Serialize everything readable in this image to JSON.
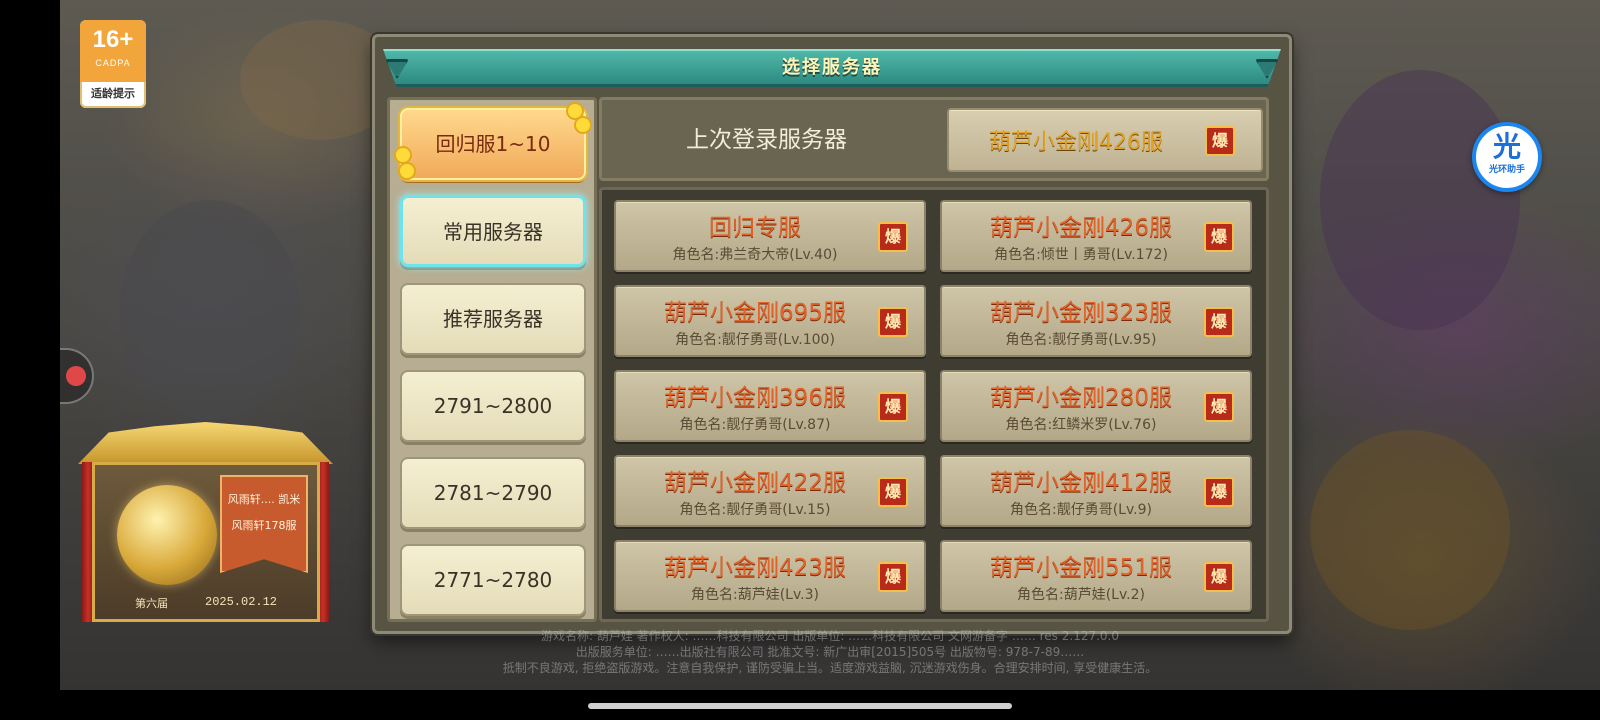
{
  "age_badge": {
    "age": "16+",
    "org": "CADPA",
    "tip": "适龄提示"
  },
  "helper": {
    "icon": "光",
    "label": "光环助手"
  },
  "honor": {
    "line1": "风雨轩.... 凯米",
    "line2": "风雨轩178服",
    "season": "第六届",
    "date": "2025.02.12"
  },
  "panel": {
    "title": "选择服务器",
    "tabs": [
      {
        "label": "回归服1~10",
        "state": "active"
      },
      {
        "label": "常用服务器",
        "state": "highlight"
      },
      {
        "label": "推荐服务器",
        "state": "normal"
      },
      {
        "label": "2791~2800",
        "state": "normal"
      },
      {
        "label": "2781~2790",
        "state": "normal"
      },
      {
        "label": "2771~2780",
        "state": "normal"
      }
    ],
    "last_login": {
      "label": "上次登录服务器",
      "server": "葫芦小金刚426服",
      "badge": "爆"
    },
    "servers": [
      {
        "name": "回归专服",
        "role": "角色名:弗兰奇大帝(Lv.40)",
        "badge": "爆"
      },
      {
        "name": "葫芦小金刚426服",
        "role": "角色名:倾世丨勇哥(Lv.172)",
        "badge": "爆"
      },
      {
        "name": "葫芦小金刚695服",
        "role": "角色名:靓仔勇哥(Lv.100)",
        "badge": "爆"
      },
      {
        "name": "葫芦小金刚323服",
        "role": "角色名:靓仔勇哥(Lv.95)",
        "badge": "爆"
      },
      {
        "name": "葫芦小金刚396服",
        "role": "角色名:靓仔勇哥(Lv.87)",
        "badge": "爆"
      },
      {
        "name": "葫芦小金刚280服",
        "role": "角色名:红鳞米罗(Lv.76)",
        "badge": "爆"
      },
      {
        "name": "葫芦小金刚422服",
        "role": "角色名:靓仔勇哥(Lv.15)",
        "badge": "爆"
      },
      {
        "name": "葫芦小金刚412服",
        "role": "角色名:靓仔勇哥(Lv.9)",
        "badge": "爆"
      },
      {
        "name": "葫芦小金刚423服",
        "role": "角色名:葫芦娃(Lv.3)",
        "badge": "爆"
      },
      {
        "name": "葫芦小金刚551服",
        "role": "角色名:葫芦娃(Lv.2)",
        "badge": "爆"
      }
    ]
  },
  "footer": {
    "line1": "游戏名称: 葫芦娃  著作权人: ……科技有限公司  出版单位: ……科技有限公司  文网游备字 ……  res 2.127.0.0",
    "line2": "出版服务单位: ……出版社有限公司  批准文号: 新广出审[2015]505号  出版物号: 978-7-89……",
    "line3": "抵制不良游戏, 拒绝盗版游戏。注意自我保护, 谨防受骗上当。适度游戏益脑, 沉迷游戏伤身。合理安排时间, 享受健康生活。"
  },
  "colors": {
    "accent": "#2e8a82",
    "server_name": "#e0632a",
    "hot_badge": "#b82a1a"
  }
}
